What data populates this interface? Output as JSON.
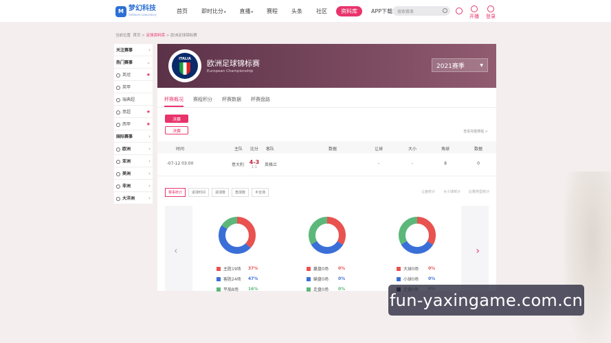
{
  "header": {
    "logo_mark": "M",
    "logo_text": "梦幻科技",
    "logo_sub": "Software Laboratory",
    "nav": [
      {
        "label": "首页",
        "active": false,
        "dropdown": false
      },
      {
        "label": "即时比分",
        "active": false,
        "dropdown": true
      },
      {
        "label": "直播",
        "active": false,
        "dropdown": true
      },
      {
        "label": "赛程",
        "active": false,
        "dropdown": false
      },
      {
        "label": "头条",
        "active": false,
        "dropdown": false
      },
      {
        "label": "社区",
        "active": false,
        "dropdown": false
      },
      {
        "label": "资料库",
        "active": true,
        "dropdown": false
      },
      {
        "label": "APP下载",
        "active": false,
        "dropdown": false
      }
    ],
    "search_placeholder": "搜索赛事",
    "open_label": "开播",
    "login_label": "登录"
  },
  "breadcrumb": {
    "prefix": "当前位置",
    "home": "首页",
    "db": "足球资料库",
    "current": "欧洲足球锦标赛",
    "sep": ">"
  },
  "sidebar": [
    {
      "label": "关注赛事",
      "type": "head",
      "mark": "chevron-right"
    },
    {
      "label": "热门赛事",
      "type": "head",
      "mark": "chevron-down"
    },
    {
      "label": "英冠",
      "type": "sub",
      "mark": "star"
    },
    {
      "label": "英甲",
      "type": "sub",
      "mark": ""
    },
    {
      "label": "瑞典超",
      "type": "sub",
      "mark": ""
    },
    {
      "label": "意超",
      "type": "sub",
      "mark": "star"
    },
    {
      "label": "西甲",
      "type": "sub",
      "mark": "star"
    },
    {
      "label": "国际赛事",
      "type": "head",
      "mark": "chevron-right"
    },
    {
      "label": "欧洲",
      "type": "head",
      "mark": "chevron-right"
    },
    {
      "label": "亚洲",
      "type": "head",
      "mark": "chevron-right"
    },
    {
      "label": "美洲",
      "type": "head",
      "mark": "chevron-right"
    },
    {
      "label": "非洲",
      "type": "head",
      "mark": "chevron-right"
    },
    {
      "label": "大洋洲",
      "type": "head",
      "mark": "chevron-right"
    }
  ],
  "banner": {
    "badge_text": "ITALIA",
    "title": "欧洲足球锦标赛",
    "subtitle": "European Championship",
    "season": "2021赛季"
  },
  "tabs": [
    "杯赛概况",
    "赛程积分",
    "杯赛数据",
    "杯赛盘路"
  ],
  "stage_buttons": [
    "决赛",
    "决赛"
  ],
  "view_all": "查看完整赛程 >",
  "table": {
    "headers": [
      "时间",
      "主队",
      "比分",
      "客队",
      "数据",
      "让球",
      "大小",
      "角球",
      "数据"
    ],
    "rows": [
      {
        "time": "-07-12 03:00",
        "home": "意大利",
        "score": "4-3",
        "half": "1-1",
        "away": "英格兰",
        "data": "",
        "handicap": "-",
        "overunder": "-",
        "corners": "8",
        "data2": "0"
      }
    ]
  },
  "stat_tabs": [
    "赛事统计",
    "进球时间",
    "进球数",
    "角球数",
    "半全场"
  ],
  "stat_links": [
    "让盘统计",
    "大小球统计",
    "比赛类型统计"
  ],
  "colors": {
    "accent": "#e8336b",
    "red": "#e8524f",
    "blue": "#3b6fd8",
    "green": "#5cb87a",
    "dark": "#333333"
  },
  "chart_data": [
    {
      "type": "pie",
      "labels": [
        "主胜19场",
        "客胜24场",
        "平局8场"
      ],
      "values": [
        37,
        47,
        16
      ],
      "pct": [
        "37%",
        "47%",
        "16%"
      ]
    },
    {
      "type": "pie",
      "labels": [
        "赢盘0场",
        "输盘0场",
        "走盘0场"
      ],
      "values": [
        0,
        0,
        0
      ],
      "pct": [
        "0%",
        "0%",
        "0%"
      ]
    },
    {
      "type": "pie",
      "labels": [
        "大球0场",
        "小球0场",
        "走盘0场"
      ],
      "values": [
        0,
        0,
        0
      ],
      "pct": [
        "0%",
        "0%",
        "0%"
      ]
    }
  ],
  "watermark": "fun-yaxingame.com.cn"
}
